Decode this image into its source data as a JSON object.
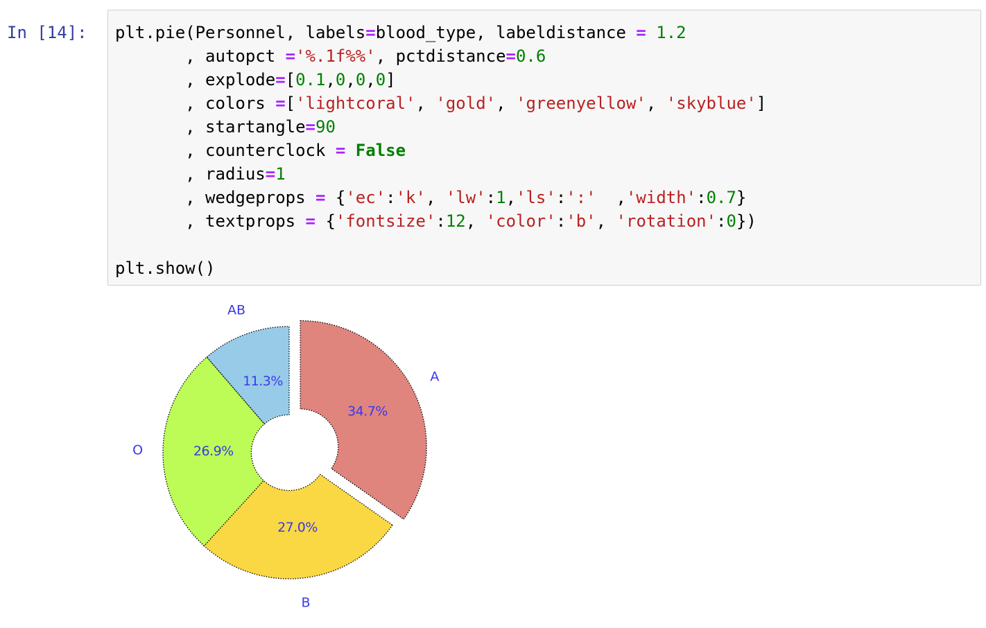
{
  "notebook": {
    "prompt": "In [14]:",
    "code_lines": [
      [
        [
          "plain",
          "plt.pie(Personnel, labels"
        ],
        [
          "op",
          "="
        ],
        [
          "plain",
          "blood_type, labeldistance "
        ],
        [
          "op",
          "="
        ],
        [
          "plain",
          " "
        ],
        [
          "num",
          "1.2"
        ]
      ],
      [
        [
          "plain",
          "       , autopct "
        ],
        [
          "op",
          "="
        ],
        [
          "str",
          "'%.1f%%'"
        ],
        [
          "plain",
          ", pctdistance"
        ],
        [
          "op",
          "="
        ],
        [
          "num",
          "0.6"
        ]
      ],
      [
        [
          "plain",
          "       , explode"
        ],
        [
          "op",
          "="
        ],
        [
          "plain",
          "["
        ],
        [
          "num",
          "0.1"
        ],
        [
          "plain",
          ","
        ],
        [
          "num",
          "0"
        ],
        [
          "plain",
          ","
        ],
        [
          "num",
          "0"
        ],
        [
          "plain",
          ","
        ],
        [
          "num",
          "0"
        ],
        [
          "plain",
          "]"
        ]
      ],
      [
        [
          "plain",
          "       , colors "
        ],
        [
          "op",
          "="
        ],
        [
          "plain",
          "["
        ],
        [
          "str",
          "'lightcoral'"
        ],
        [
          "plain",
          ", "
        ],
        [
          "str",
          "'gold'"
        ],
        [
          "plain",
          ", "
        ],
        [
          "str",
          "'greenyellow'"
        ],
        [
          "plain",
          ", "
        ],
        [
          "str",
          "'skyblue'"
        ],
        [
          "plain",
          "]"
        ]
      ],
      [
        [
          "plain",
          "       , startangle"
        ],
        [
          "op",
          "="
        ],
        [
          "num",
          "90"
        ]
      ],
      [
        [
          "plain",
          "       , counterclock "
        ],
        [
          "op",
          "="
        ],
        [
          "plain",
          " "
        ],
        [
          "kw",
          "False"
        ]
      ],
      [
        [
          "plain",
          "       , radius"
        ],
        [
          "op",
          "="
        ],
        [
          "num",
          "1"
        ]
      ],
      [
        [
          "plain",
          "       , wedgeprops "
        ],
        [
          "op",
          "="
        ],
        [
          "plain",
          " {"
        ],
        [
          "str",
          "'ec'"
        ],
        [
          "plain",
          ":"
        ],
        [
          "str",
          "'k'"
        ],
        [
          "plain",
          ", "
        ],
        [
          "str",
          "'lw'"
        ],
        [
          "plain",
          ":"
        ],
        [
          "num",
          "1"
        ],
        [
          "plain",
          ","
        ],
        [
          "str",
          "'ls'"
        ],
        [
          "plain",
          ":"
        ],
        [
          "str",
          "':'"
        ],
        [
          "plain",
          "  ,"
        ],
        [
          "str",
          "'width'"
        ],
        [
          "plain",
          ":"
        ],
        [
          "num",
          "0.7"
        ],
        [
          "plain",
          "}"
        ]
      ],
      [
        [
          "plain",
          "       , textprops "
        ],
        [
          "op",
          "="
        ],
        [
          "plain",
          " {"
        ],
        [
          "str",
          "'fontsize'"
        ],
        [
          "plain",
          ":"
        ],
        [
          "num",
          "12"
        ],
        [
          "plain",
          ", "
        ],
        [
          "str",
          "'color'"
        ],
        [
          "plain",
          ":"
        ],
        [
          "str",
          "'b'"
        ],
        [
          "plain",
          ", "
        ],
        [
          "str",
          "'rotation'"
        ],
        [
          "plain",
          ":"
        ],
        [
          "num",
          "0"
        ],
        [
          "plain",
          "})"
        ]
      ],
      [
        [
          "plain",
          ""
        ]
      ],
      [
        [
          "plain",
          "plt.show()"
        ]
      ]
    ]
  },
  "chart_data": {
    "type": "pie",
    "categories": [
      "A",
      "B",
      "O",
      "AB"
    ],
    "values": [
      34.7,
      27.0,
      26.9,
      11.3
    ],
    "pct_labels": [
      "34.7%",
      "27.0%",
      "26.9%",
      "11.3%"
    ],
    "colors": [
      "#e0847e",
      "#fad843",
      "#bdfb56",
      "#98cbe8"
    ],
    "explode": [
      0.1,
      0,
      0,
      0
    ],
    "start_angle": 90,
    "counterclock": false,
    "radius": 1,
    "wedge_width": 0.7,
    "label_distance": 1.2,
    "pct_distance": 0.6,
    "edge_color": "#000000",
    "text_color": "#3a3ae8"
  }
}
